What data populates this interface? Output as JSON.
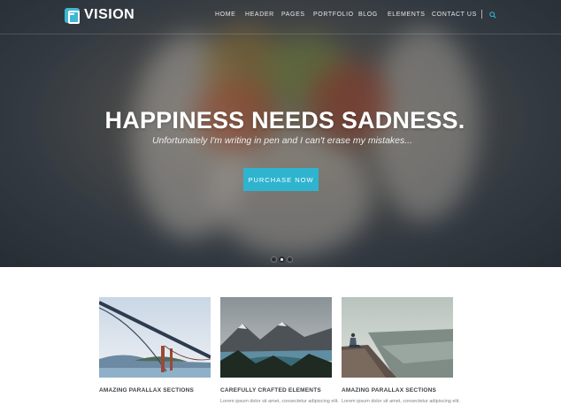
{
  "header": {
    "logo_text": "VISION",
    "nav": [
      {
        "label": "HOME"
      },
      {
        "label": "HEADER"
      },
      {
        "label": "PAGES"
      },
      {
        "label": "PORTFOLIO"
      },
      {
        "label": "BLOG"
      },
      {
        "label": "ELEMENTS"
      },
      {
        "label": "CONTACT US"
      }
    ],
    "search_icon": "search-icon"
  },
  "hero": {
    "title": "HAPPINESS NEEDS SADNESS.",
    "subtitle": "Unfortunately I'm writing in pen and I can't erase my mistakes...",
    "cta_label": "PURCHASE NOW",
    "slides_total": 3,
    "slide_active": 2
  },
  "cards": [
    {
      "title": "AMAZING PARALLAX SECTIONS",
      "text": ""
    },
    {
      "title": "CAREFULLY CRAFTED ELEMENTS",
      "text": "Lorem ipsum dolor sit amet, consectetur adipiscing elit."
    },
    {
      "title": "AMAZING PARALLAX SECTIONS",
      "text": "Lorem ipsum dolor sit amet, consectetur adipiscing elit."
    }
  ],
  "colors": {
    "accent": "#2fb4cf",
    "hero_overlay": "#3e444b",
    "card_title": "#3a3f45"
  }
}
